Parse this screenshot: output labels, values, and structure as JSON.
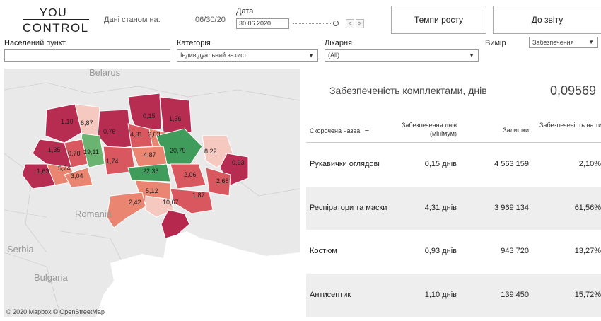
{
  "header": {
    "logo_line1": "YOU",
    "logo_line2": "CONTROL",
    "date_label": "Дані станом на:",
    "date_value": "06/30/20",
    "date_title": "Дата",
    "date_input": "30.06.2020",
    "prev_label": "<",
    "next_label": ">",
    "growth_button": "Темпи росту",
    "report_button": "До звіту"
  },
  "filters": {
    "settlement": {
      "label": "Населений пункт",
      "value": ""
    },
    "category": {
      "label": "Категорія",
      "value": "Індивідуальний захист"
    },
    "hospital": {
      "label": "Лікарня",
      "value": "(All)"
    },
    "measure": {
      "label": "Вимір",
      "value": "Забезпечення"
    }
  },
  "map": {
    "countries": [
      "Belarus",
      "Romania",
      "Serbia",
      "Bulgaria"
    ],
    "copyright": "© 2020 Mapbox © OpenStreetMap",
    "regions": [
      "1,10",
      "6,87",
      "0,15",
      "1,36",
      "0,76",
      "4,31",
      "3,63",
      "19,11",
      "0,78",
      "1,35",
      "20,79",
      "8,22",
      "4,87",
      "1,74",
      "5,74",
      "3,04",
      "22,36",
      "0,93",
      "1,63",
      "2,06",
      "2,68",
      "5,12",
      "1,87",
      "2,42",
      "10,67"
    ],
    "colors": {
      "red_dark": "#b72d52",
      "red": "#d9575e",
      "salmon": "#e98571",
      "pink": "#f6c9c0",
      "green": "#3f9c5a",
      "green_light": "#6ab370",
      "crimea": "#b7284f"
    }
  },
  "kpi": {
    "title": "Забезпеченість комплектами, днів",
    "value": "0,09569"
  },
  "table": {
    "headers": {
      "name": "Скорочена назва",
      "days": "Забезпечення днів (мінімум)",
      "stock": "Залишки",
      "weeks": "Забезпеченість на тиждень"
    },
    "rows": [
      {
        "name": "Рукавички оглядові",
        "days": "0,15 днів",
        "stock": "4 563 159",
        "weeks": "2,10%"
      },
      {
        "name": "Респіратори та маски",
        "days": "4,31 днів",
        "stock": "3 969 134",
        "weeks": "61,56%"
      },
      {
        "name": "Костюм",
        "days": "0,93 днів",
        "stock": "943 720",
        "weeks": "13,27%"
      },
      {
        "name": "Антисептик",
        "days": "1,10 днів",
        "stock": "139 450",
        "weeks": "15,72%"
      }
    ]
  }
}
